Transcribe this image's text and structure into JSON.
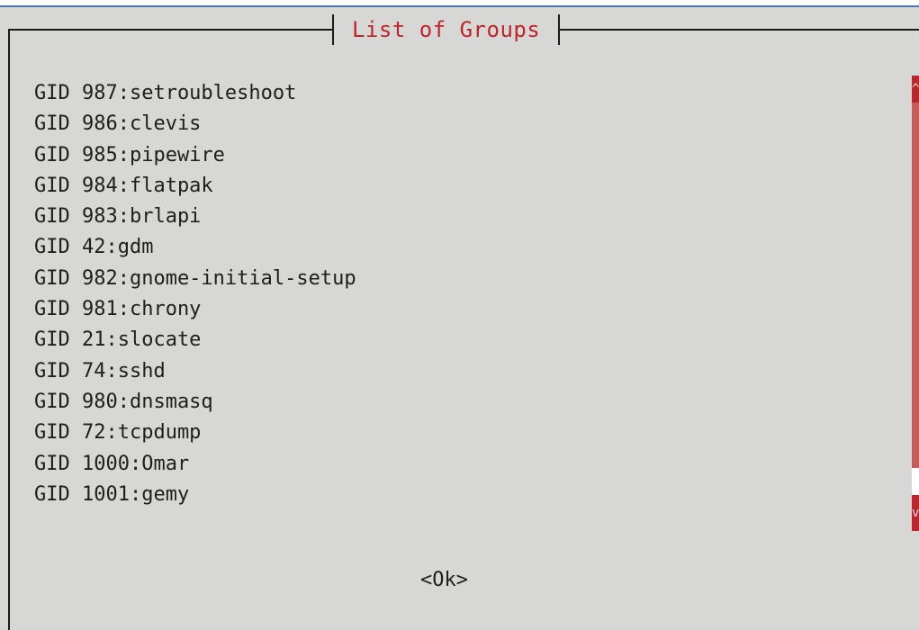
{
  "dialog": {
    "title": "List of Groups",
    "ok_label": "<Ok>"
  },
  "groups": [
    "GID 987:setroubleshoot",
    "GID 986:clevis",
    "GID 985:pipewire",
    "GID 984:flatpak",
    "GID 983:brlapi",
    "GID 42:gdm",
    "GID 982:gnome-initial-setup",
    "GID 981:chrony",
    "GID 21:slocate",
    "GID 74:sshd",
    "GID 980:dnsmasq",
    "GID 72:tcpdump",
    "GID 1000:Omar",
    "GID 1001:gemy"
  ],
  "scrollbar": {
    "up_arrow_icon": "chevron-up-icon",
    "down_arrow_icon": "chevron-down-icon"
  },
  "colors": {
    "background": "#d7d7d5",
    "title": "#c0242b",
    "text": "#1e1e1e",
    "scrollbar_track": "#c95b5b",
    "scrollbar_arrow": "#c0242b"
  }
}
